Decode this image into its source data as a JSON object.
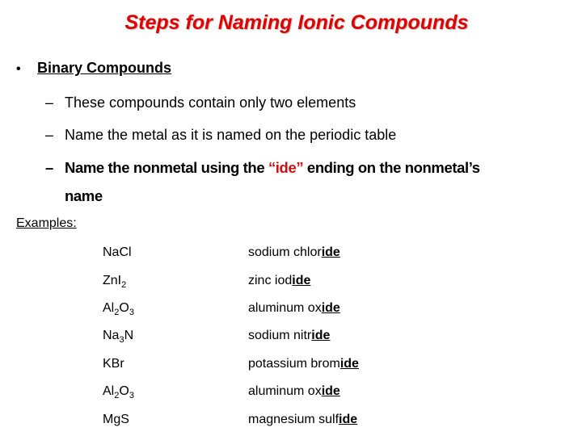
{
  "title": "Steps for Naming Ionic Compounds",
  "bullet": {
    "marker": "•",
    "label": "Binary Compounds"
  },
  "sub_bullets": {
    "dash": "–",
    "item1": "These compounds contain only two elements",
    "item2": "Name the metal as it is named on the periodic table",
    "item3_pre": "Name the nonmetal using the ",
    "item3_highlight": "“ide”",
    "item3_post": " ending on the nonmetal’s",
    "item3_cont": "name"
  },
  "highlight_color": "#d01010",
  "title_color": "#e00000",
  "examples_label": "Examples:",
  "examples": [
    {
      "formula_parts": [
        "NaCl"
      ],
      "name_stem": "sodium chlor",
      "suffix": "ide"
    },
    {
      "formula_parts": [
        "ZnI",
        "2"
      ],
      "name_stem": "zinc iod",
      "suffix": "ide"
    },
    {
      "formula_parts": [
        "Al",
        "2",
        "O",
        "3"
      ],
      "name_stem": "aluminum ox",
      "suffix": "ide"
    },
    {
      "formula_parts": [
        "Na",
        "3",
        "N"
      ],
      "name_stem": "sodium nitr",
      "suffix": "ide"
    },
    {
      "formula_parts": [
        "KBr"
      ],
      "name_stem": "potassium brom",
      "suffix": "ide"
    },
    {
      "formula_parts": [
        "Al",
        "2",
        "O",
        "3"
      ],
      "name_stem": "aluminum ox",
      "suffix": "ide"
    },
    {
      "formula_parts": [
        "MgS"
      ],
      "name_stem": "magnesium sulf",
      "suffix": "ide"
    }
  ]
}
